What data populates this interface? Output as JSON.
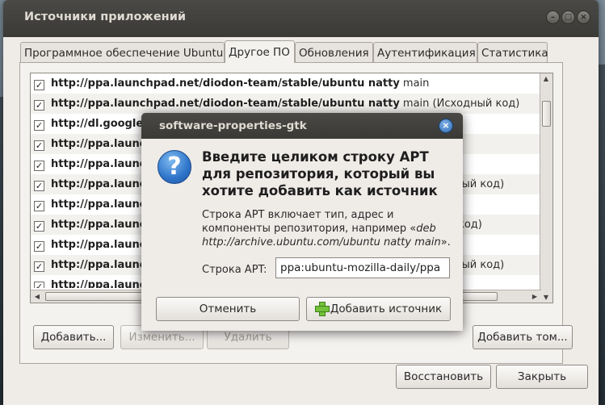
{
  "window": {
    "title": "Источники приложений",
    "controls": {
      "minimize": "–",
      "maximize": "□",
      "close": "×"
    }
  },
  "tabs": [
    {
      "label": "Программное обеспечение Ubuntu"
    },
    {
      "label": "Другое ПО"
    },
    {
      "label": "Обновления"
    },
    {
      "label": "Аутентификация"
    },
    {
      "label": "Статистика"
    }
  ],
  "sources": [
    {
      "checked": "✓",
      "uri": "http://ppa.launchpad.net/diodon-team/stable/ubuntu natty",
      "rest": " main"
    },
    {
      "checked": "✓",
      "uri": "http://ppa.launchpad.net/diodon-team/stable/ubuntu natty",
      "rest": " main (Исходный код)"
    },
    {
      "checked": "✓",
      "uri": "http://dl.google",
      "rest": ""
    },
    {
      "checked": "✓",
      "uri": "http://ppa.launc",
      "rest": ""
    },
    {
      "checked": "✓",
      "uri": "http://ppa.launc",
      "rest": ""
    },
    {
      "checked": "✓",
      "uri": "http://ppa.launc",
      "rest": ""
    },
    {
      "checked": "✓",
      "uri": "http://ppa.launc",
      "rest": ""
    },
    {
      "checked": "✓",
      "uri": "http://ppa.launc",
      "rest": ""
    },
    {
      "checked": "✓",
      "uri": "http://ppa.launc",
      "rest": ""
    },
    {
      "checked": "✓",
      "uri": "http://ppa.launc",
      "rest": ""
    },
    {
      "checked": "✓",
      "uri": "http://ppa.launc",
      "rest": ""
    }
  ],
  "sources_tail": {
    "r5": "ный код)",
    "r7": "код)",
    "r9": "ный код)"
  },
  "buttons": {
    "add": "Добавить...",
    "edit": "Изменить...",
    "remove": "Удалить",
    "add_volume": "Добавить том...",
    "restore": "Восстановить",
    "close": "Закрыть"
  },
  "dialog": {
    "title": "software-properties-gtk",
    "close": "×",
    "icon": "?",
    "heading": "Введите целиком строку APT для репозитория, который вы хотите добавить как источник",
    "desc_plain": "Строка APT включает тип, адрес и компоненты репозитория, например «",
    "desc_example": "deb http://archive.ubuntu.com/ubuntu natty main",
    "desc_end": "».",
    "field_label": "Строка APT:",
    "field_value": "ppa:ubuntu-mozilla-daily/ppa",
    "cancel": "Отменить",
    "add_source": "Добавить источник"
  }
}
